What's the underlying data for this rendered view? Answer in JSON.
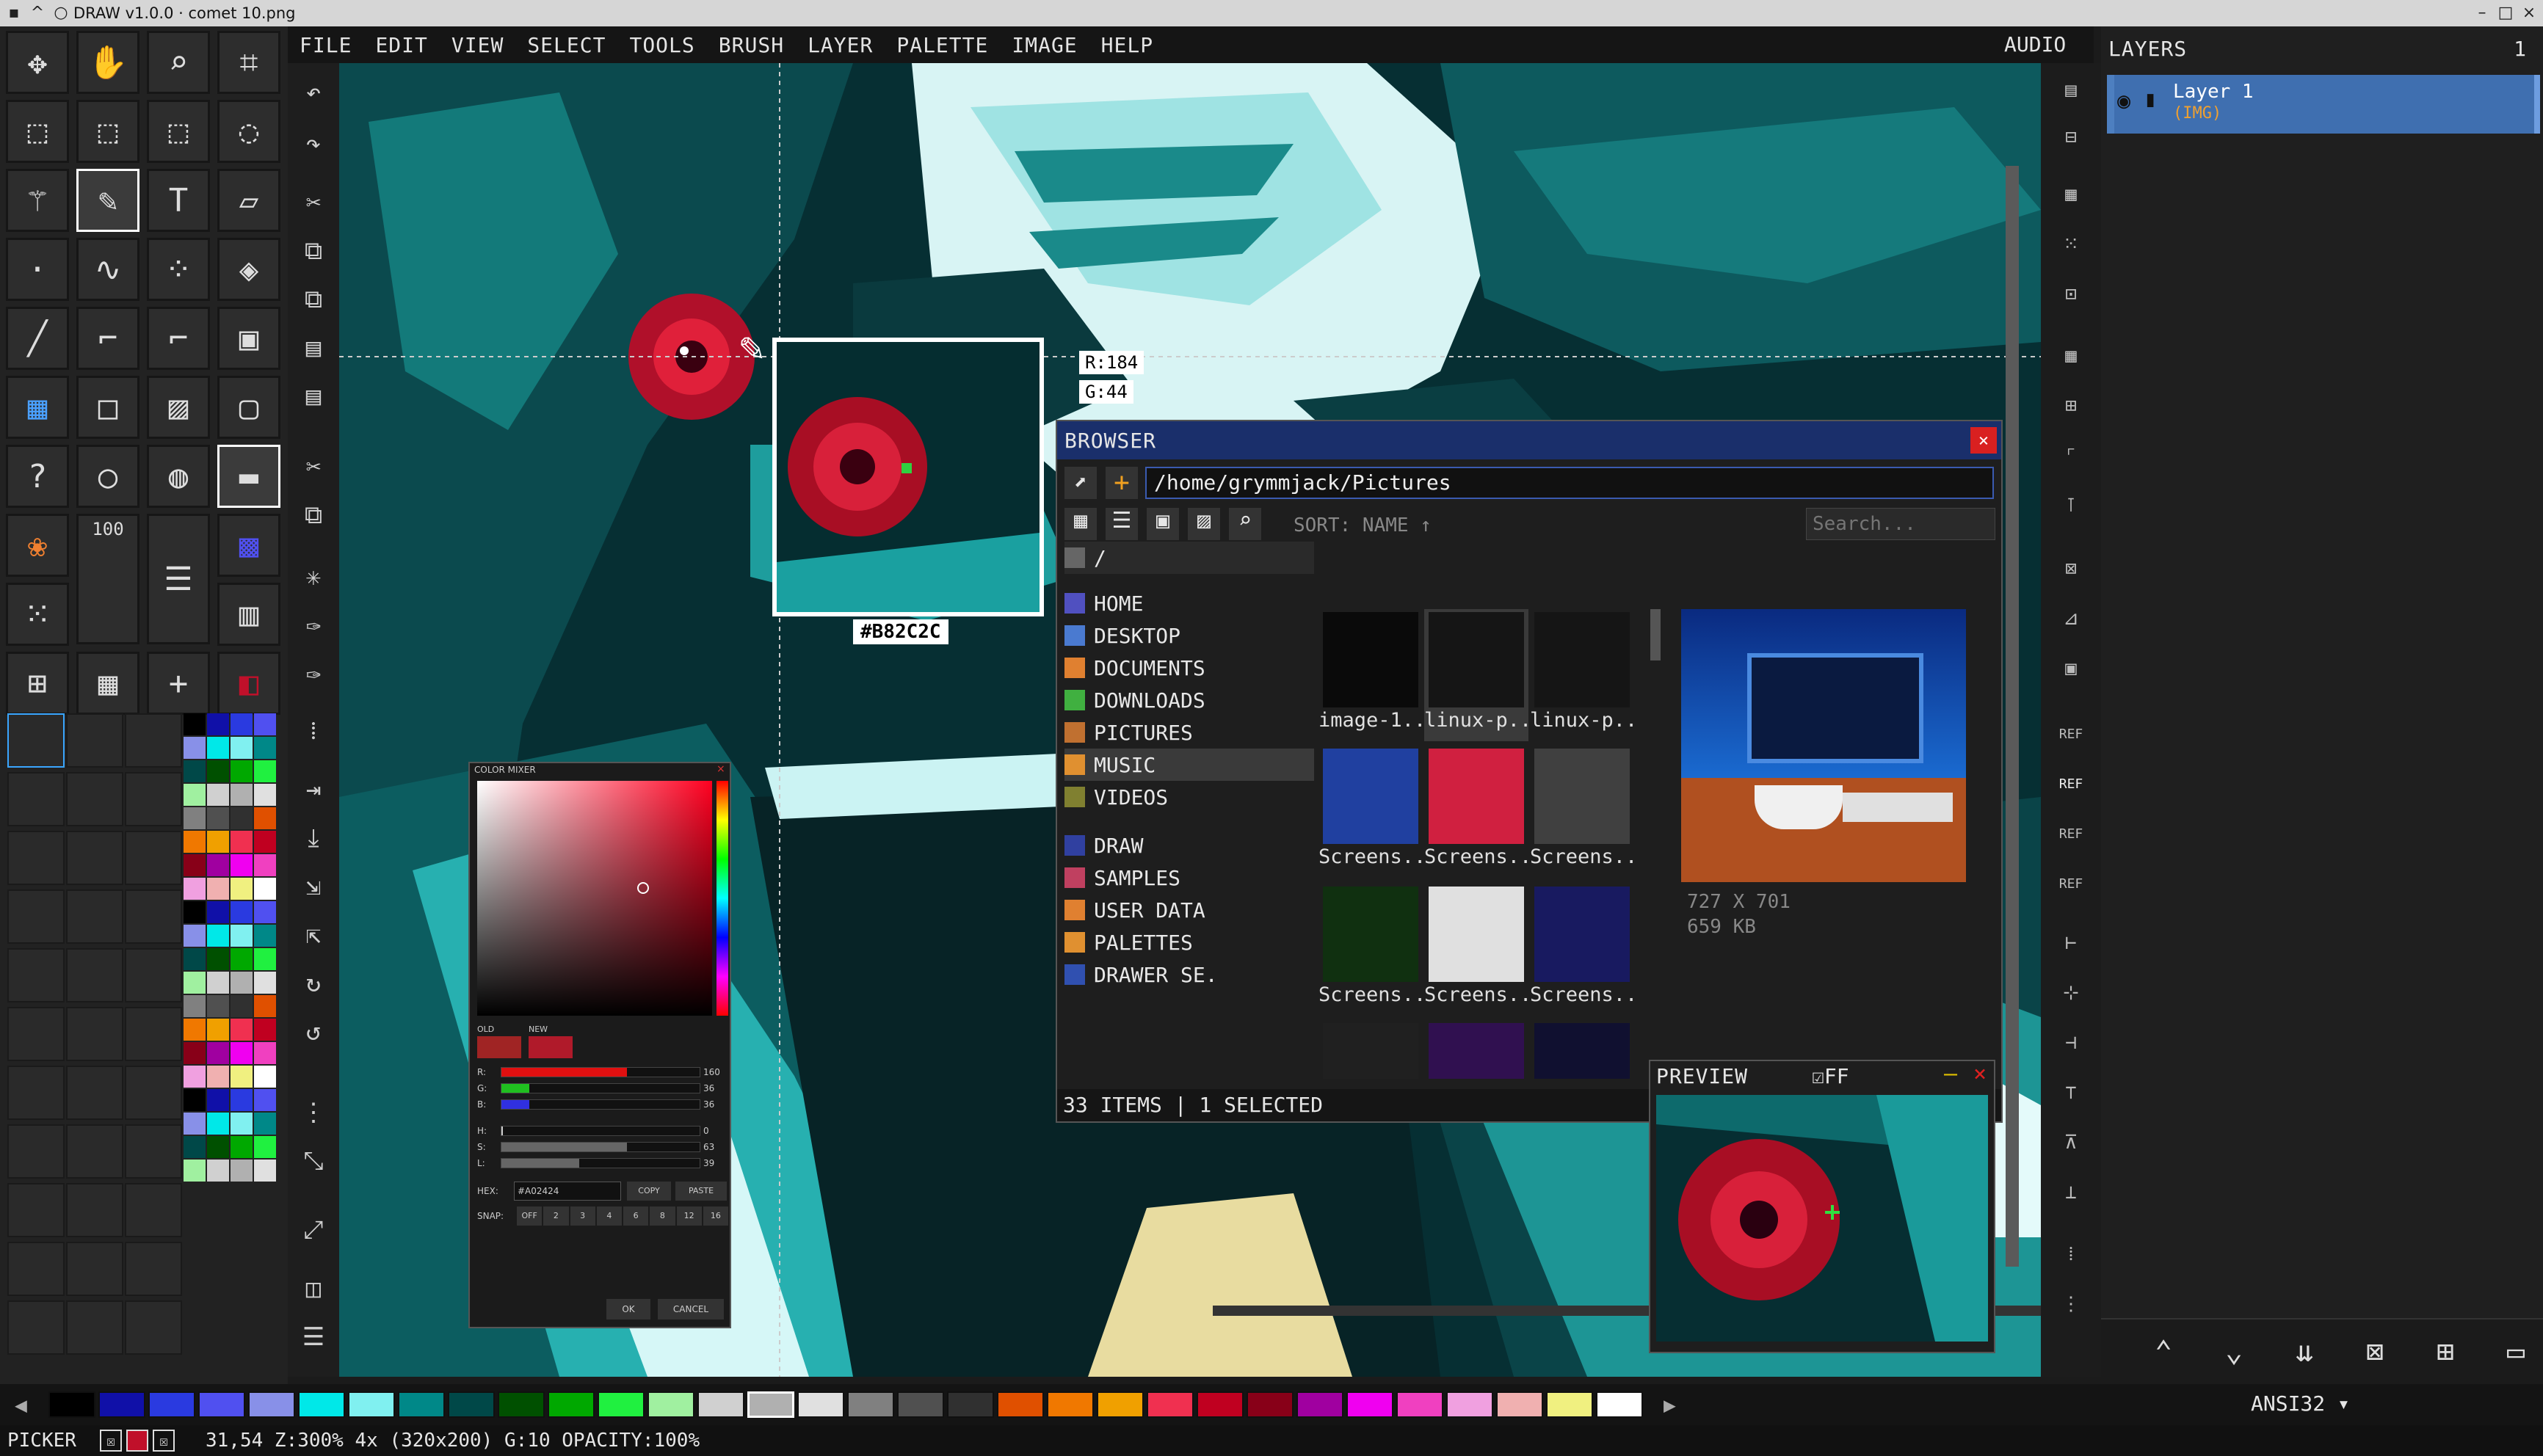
{
  "window": {
    "title": "DRAW v1.0.0 · comet 10.png"
  },
  "menu": [
    "FILE",
    "EDIT",
    "VIEW",
    "SELECT",
    "TOOLS",
    "BRUSH",
    "LAYER",
    "PALETTE",
    "IMAGE",
    "HELP"
  ],
  "audio_label": "AUDIO",
  "tools": {
    "brush_size": "100"
  },
  "picker": {
    "readout_r": "R:184",
    "readout_g": "G:44",
    "hex": "#B82C2C"
  },
  "browser": {
    "title": "BROWSER",
    "path": "/home/grymmjack/Pictures",
    "sort_label": "SORT: NAME",
    "search_placeholder": "Search...",
    "root": "/",
    "places": [
      "HOME",
      "DESKTOP",
      "DOCUMENTS",
      "DOWNLOADS",
      "PICTURES",
      "MUSIC",
      "VIDEOS"
    ],
    "places2": [
      "DRAW",
      "SAMPLES",
      "USER DATA",
      "PALETTES",
      "DRAWER SE."
    ],
    "thumbs": [
      "image-1..",
      "linux-p..",
      "linux-p..",
      "Screens..",
      "Screens..",
      "Screens..",
      "Screens..",
      "Screens..",
      "Screens..",
      "",
      "",
      ""
    ],
    "preview_size": "727 X 701",
    "preview_filesize": "659 KB",
    "status": "33 ITEMS | 1 SELECTED"
  },
  "preview": {
    "title": "PREVIEW",
    "ff_label": "FF"
  },
  "mixer": {
    "title": "COLOR MIXER",
    "old_label": "OLD",
    "new_label": "NEW",
    "r_label": "R:",
    "g_label": "G:",
    "b_label": "B:",
    "h_label": "H:",
    "s_label": "S:",
    "l_label": "L:",
    "r_val": "160",
    "g_val": "36",
    "b_val": "36",
    "h_val": "0",
    "s_val": "63",
    "l_val": "39",
    "hex_label": "HEX:",
    "hex_val": "#A02424",
    "copy": "COPY",
    "paste": "PASTE",
    "snap_label": "SNAP:",
    "snap_opts": [
      "OFF",
      "2",
      "3",
      "4",
      "6",
      "8",
      "12",
      "16"
    ],
    "ok": "OK",
    "cancel": "CANCEL"
  },
  "layers": {
    "title": "LAYERS",
    "count": "1",
    "layer_name": "Layer 1",
    "layer_type": "(IMG)"
  },
  "palette_name": "ANSI32",
  "status": {
    "tool": "PICKER",
    "info": "31,54 Z:300% 4x (320x200) G:10 OPACITY:100%"
  },
  "colors": {
    "menu_bg": "#151515",
    "accent": "#1a2f6b",
    "layer_sel": "#3f6fb0",
    "close": "#d92020",
    "palette": [
      "#000000",
      "#1010a8",
      "#2a3ae0",
      "#5050f0",
      "#8890e8",
      "#00e8e8",
      "#80f0f0",
      "#008888",
      "#004848",
      "#005000",
      "#00a800",
      "#20f040",
      "#a0f0a0",
      "#d0d0d0",
      "#b0b0b0",
      "#e0e0e0",
      "#808080",
      "#505050",
      "#303030",
      "#e05000",
      "#f07800",
      "#f0a000",
      "#f03050",
      "#c00020",
      "#880018",
      "#a000a0",
      "#f000f0",
      "#f040c0",
      "#f0a0e0",
      "#f0b0b0",
      "#f0f080",
      "#ffffff"
    ]
  }
}
